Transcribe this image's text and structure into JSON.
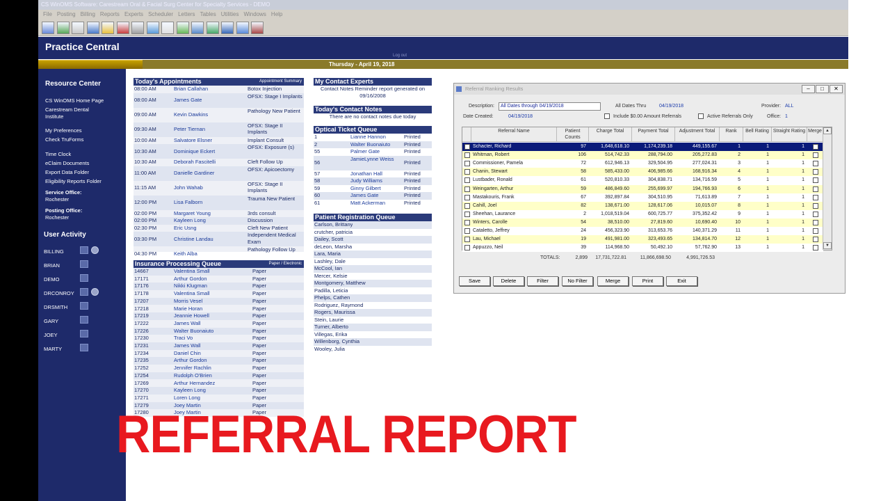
{
  "app": {
    "title": "CS WinOMS Software:",
    "title_ext": "Carestream Oral & Facial Surg Center for Specialty Services - DEMO",
    "menu": [
      "File",
      "Posting",
      "Billing",
      "Reports",
      "Experts",
      "Scheduler",
      "Letters",
      "Tables",
      "Utilities",
      "Windows",
      "Help"
    ]
  },
  "header": {
    "title": "Practice Central",
    "logout": "Log out",
    "date": "Thursday - April 19, 2018"
  },
  "sidebar": {
    "resource_title": "Resource Center",
    "links": [
      "CS WinOMS Home Page",
      "Carestream Dental Institute",
      "My Preferences",
      "Check TruForms",
      "Time Clock",
      "eClaim Documents",
      "Export Data Folder",
      "Eligibility Reports Folder"
    ],
    "service_label": "Service Office:",
    "service_value": "Rochester",
    "posting_label": "Posting Office:",
    "posting_value": "Rochester",
    "user_title": "User Activity",
    "users": [
      "BILLING",
      "BRIAN",
      "DEMO",
      "DRCONROY",
      "DRSMITH",
      "GARY",
      "JOEY",
      "MARTY"
    ]
  },
  "appointments": {
    "title": "Today's Appointments",
    "link": "Appointment Summary",
    "rows": [
      [
        "08:00 AM",
        "Brian Callahan",
        "Botox Injection"
      ],
      [
        "08:00 AM",
        "James Gate",
        "OFSX: Stage I Implants"
      ],
      [
        "09:00 AM",
        "Kevin Dawkins",
        "Pathology New Patient"
      ],
      [
        "09:30 AM",
        "Peter Tiernan",
        "OFSX: Stage II Implants"
      ],
      [
        "10:00 AM",
        "Salvatore Elsner",
        "Implant Consult"
      ],
      [
        "10:30 AM",
        "Dominique Eckert",
        "OFSX: Exposure (s)"
      ],
      [
        "10:30 AM",
        "Deborah Fascitelli",
        "Cleft Follow Up"
      ],
      [
        "11:00 AM",
        "Danielle Gardiner",
        "OFSX: Apicoectomy"
      ],
      [
        "11:15 AM",
        "John Wahab",
        "OFSX: Stage II Implants"
      ],
      [
        "12:00 PM",
        "Lisa Falborn",
        "Trauma New Patient"
      ],
      [
        "02:00 PM",
        "Margaret Young",
        "3rds consult"
      ],
      [
        "02:00 PM",
        "Kayleen Long",
        "Discussion"
      ],
      [
        "02:30 PM",
        "Eric Usng",
        "Cleft New Patient"
      ],
      [
        "03:30 PM",
        "Christine Landau",
        "Independent Medical Exam"
      ],
      [
        "04:30 PM",
        "Keith Alba",
        "Pathology Follow Up"
      ]
    ]
  },
  "insurance": {
    "title": "Insurance Processing Queue",
    "link": "Paper / Electronic",
    "rows": [
      [
        "14667",
        "Valentina Small",
        "Paper"
      ],
      [
        "17171",
        "Arthur Gordon",
        "Paper"
      ],
      [
        "17176",
        "Nikki Klugman",
        "Paper"
      ],
      [
        "17178",
        "Valentina Small",
        "Paper"
      ],
      [
        "17207",
        "Morris Vesel",
        "Paper"
      ],
      [
        "17218",
        "Marie Horan",
        "Paper"
      ],
      [
        "17219",
        "Jeannie Howell",
        "Paper"
      ],
      [
        "17222",
        "James Wall",
        "Paper"
      ],
      [
        "17226",
        "Walter Buonaiuto",
        "Paper"
      ],
      [
        "17230",
        "Traci Vo",
        "Paper"
      ],
      [
        "17231",
        "James Wall",
        "Paper"
      ],
      [
        "17234",
        "Daniel Chin",
        "Paper"
      ],
      [
        "17235",
        "Arthur Gordon",
        "Paper"
      ],
      [
        "17252",
        "Jennifer Rachlin",
        "Paper"
      ],
      [
        "17254",
        "Rudolph O'Brien",
        "Paper"
      ],
      [
        "17269",
        "Arthur Hernandez",
        "Paper"
      ],
      [
        "17270",
        "Kayleen Long",
        "Paper"
      ],
      [
        "17271",
        "Loren Long",
        "Paper"
      ],
      [
        "17279",
        "Joey Martin",
        "Paper"
      ],
      [
        "17280",
        "Joey Martin",
        "Paper"
      ]
    ]
  },
  "contact_experts": {
    "title": "My Contact Experts",
    "text": "Contact Notes Reminder report generated on 09/16/2008"
  },
  "contact_notes": {
    "title": "Today's Contact Notes",
    "text": "There are no contact notes due today"
  },
  "optical": {
    "title": "Optical Ticket Queue",
    "rows": [
      [
        "1",
        "Lianne Hannon",
        "Printed"
      ],
      [
        "2",
        "Walter Buonaiuto",
        "Printed"
      ],
      [
        "55",
        "Palmer Gate",
        "Printed"
      ],
      [
        "56",
        "JamieLynne Weiss",
        "Printed"
      ],
      [
        "57",
        "Jonathan Hall",
        "Printed"
      ],
      [
        "58",
        "Judy Williams",
        "Printed"
      ],
      [
        "59",
        "Ginny Gilbert",
        "Printed"
      ],
      [
        "60",
        "James Gate",
        "Printed"
      ],
      [
        "61",
        "Matt Ackerman",
        "Printed"
      ]
    ]
  },
  "registration": {
    "title": "Patient Registration Queue",
    "rows": [
      "Carlson, Brittany",
      "crutcher, patricia",
      "Dailey, Scott",
      "deLeon, Marsha",
      "Lara, Maria",
      "Lashley, Dale",
      "McCool, Ian",
      "Mercer, Kelsie",
      "Montgomery, Matthew",
      "Padilla, Leticia",
      "Phelps, Cathen",
      "Rodriguez, Raymond",
      "Rogers, Maurissa",
      "Stein, Laurie",
      "Turner, Alberto",
      "Villegas, Erika",
      "Willenborg, Cynthia",
      "Wooley, Julia"
    ]
  },
  "dialog": {
    "title": "Referral Ranking Results",
    "desc_label": "Description:",
    "desc_value": "All Dates through 04/19/2018",
    "all_dates_label": "All Dates Thru",
    "all_dates_value": "04/19/2018",
    "provider_label": "Provider:",
    "provider_value": "ALL",
    "date_created_label": "Date Created:",
    "date_created_value": "04/19/2018",
    "include_zero": "Include $0.00 Amount Referrals",
    "active_only": "Active Referrals Only",
    "office_label": "Office:",
    "office_value": "1",
    "columns": [
      "Referral Name",
      "Patient Counts",
      "Charge Total",
      "Payment Total",
      "Adjustment Total",
      "Rank",
      "Bell Rating",
      "Straight Rating",
      "Merge"
    ],
    "rows": [
      [
        "Schacter, Richard",
        "97",
        "1,648,618.10",
        "1,174,239.18",
        "449,155.67",
        "1",
        "1",
        "1"
      ],
      [
        "Whitman, Robert",
        "106",
        "514,742.33",
        "288,794.00",
        "205,272.83",
        "2",
        "1",
        "1"
      ],
      [
        "Commissioner, Pamela",
        "72",
        "612,946.13",
        "329,504.95",
        "277,024.31",
        "3",
        "1",
        "1"
      ],
      [
        "Chanin, Stewart",
        "58",
        "585,433.00",
        "406,985.66",
        "168,916.34",
        "4",
        "1",
        "1"
      ],
      [
        "Lustbader, Ronald",
        "61",
        "520,810.33",
        "304,838.71",
        "134,716.59",
        "5",
        "1",
        "1"
      ],
      [
        "Weingarten, Arthur",
        "59",
        "486,849.60",
        "255,699.97",
        "194,766.93",
        "6",
        "1",
        "1"
      ],
      [
        "Mastakouris, Frank",
        "67",
        "392,897.84",
        "304,510.95",
        "71,613.89",
        "7",
        "1",
        "1"
      ],
      [
        "Cahill, Joel",
        "82",
        "138,671.00",
        "128,617.06",
        "10,015.07",
        "8",
        "1",
        "1"
      ],
      [
        "Sheehan, Laurance",
        "2",
        "1,018,519.04",
        "600,725.77",
        "375,352.42",
        "9",
        "1",
        "1"
      ],
      [
        "Winters, Carolle",
        "54",
        "38,510.00",
        "27,819.60",
        "10,690.40",
        "10",
        "1",
        "1"
      ],
      [
        "Cataletto, Jeffrey",
        "24",
        "456,323.90",
        "313,653.76",
        "140,371.29",
        "11",
        "1",
        "1"
      ],
      [
        "Lau, Michael",
        "19",
        "491,981.00",
        "323,493.65",
        "134,814.70",
        "12",
        "1",
        "1"
      ],
      [
        "Appuzzo, Neil",
        "39",
        "114,968.50",
        "50,492.10",
        "57,762.90",
        "13",
        "1",
        "1"
      ]
    ],
    "totals_label": "TOTALS:",
    "totals": [
      "2,899",
      "17,731,722.81",
      "11,866,698.50",
      "4,991,726.53"
    ],
    "buttons": [
      "Save",
      "Delete",
      "Filter",
      "No Filter",
      "Merge",
      "Print",
      "Exit"
    ]
  },
  "overlay": {
    "text": "REFERRAL REPORT"
  },
  "colors": {
    "navy": "#1e2a6a",
    "gold": "#c7a100",
    "overlay_red": "#e8191f",
    "row_yellow": "#ffffc8",
    "selected": "#0a1a7a"
  }
}
